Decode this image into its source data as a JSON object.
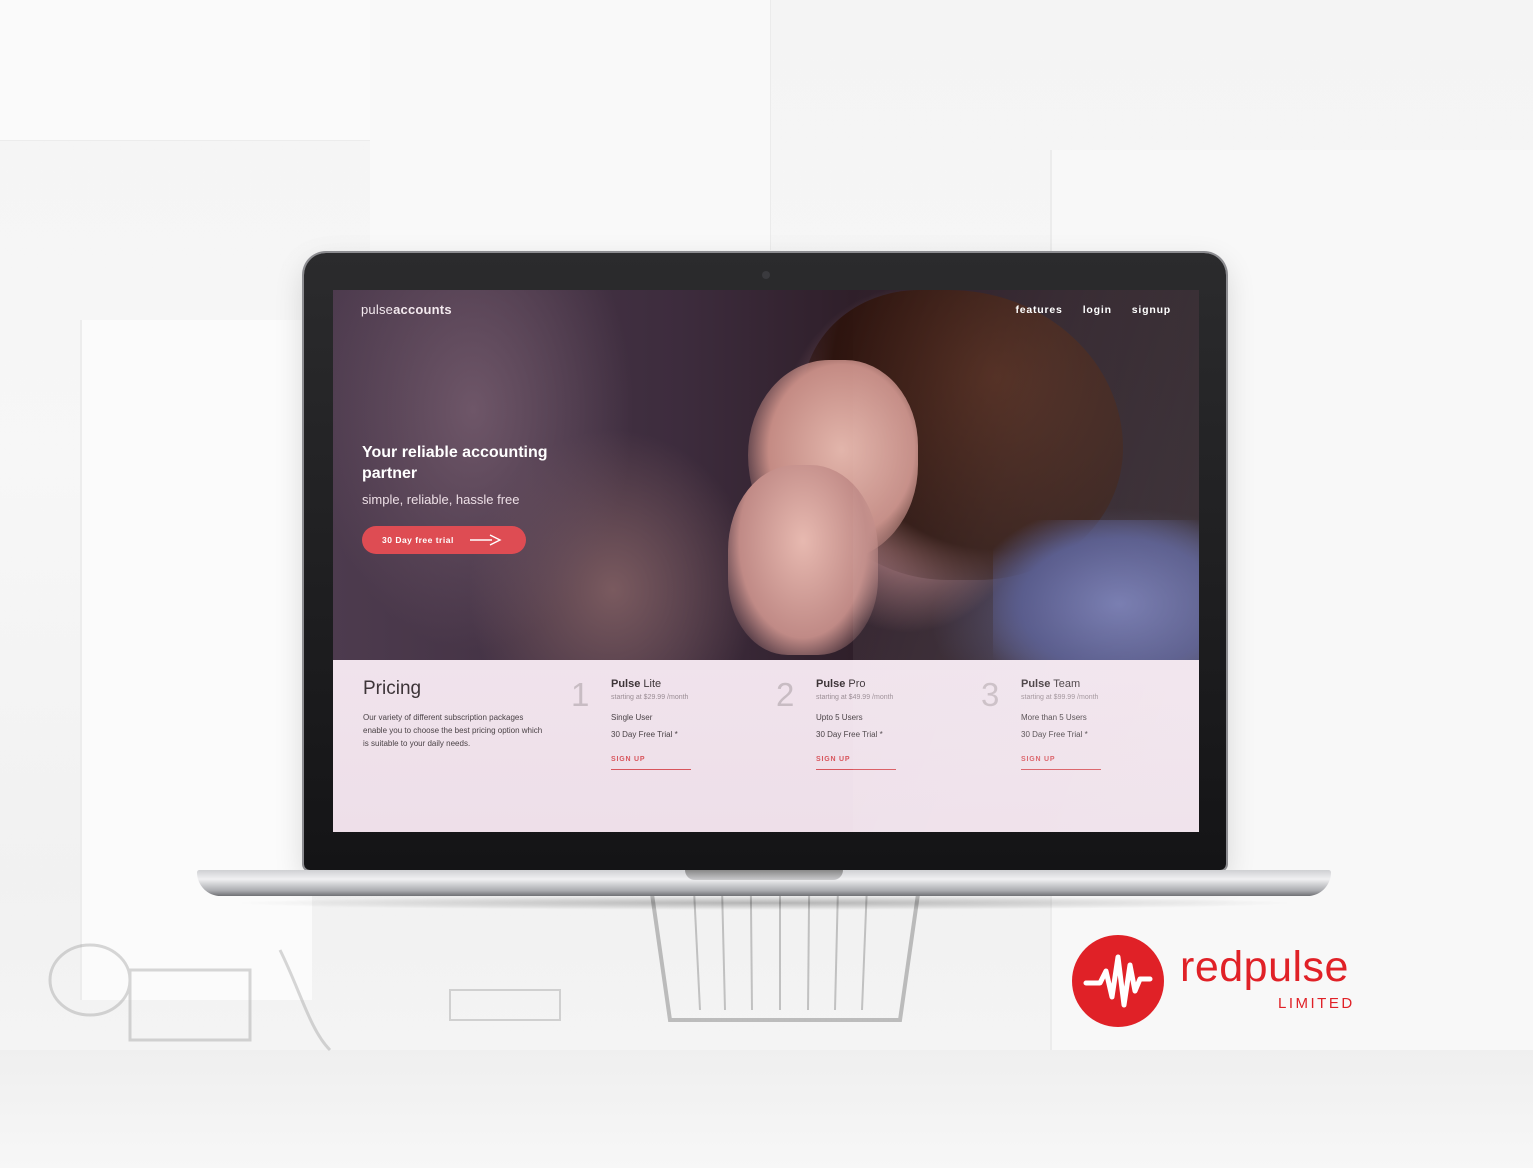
{
  "site": {
    "brand_light": "pulse",
    "brand_bold": "accounts",
    "nav": [
      "features",
      "login",
      "signup"
    ]
  },
  "hero": {
    "title": "Your reliable accounting partner",
    "subtitle": "simple, reliable, hassle free",
    "cta_label": "30 Day free trial"
  },
  "pricing": {
    "title": "Pricing",
    "description": "Our variety of different subscription packages enable you to choose the best pricing option which is suitable to your daily needs.",
    "plans": [
      {
        "number": "1",
        "name_bold": "Pulse",
        "name_light": "Lite",
        "price": "starting at $29.99 /month",
        "feature1": "Single User",
        "feature2": "30 Day Free Trial *",
        "signup": "SIGN UP"
      },
      {
        "number": "2",
        "name_bold": "Pulse",
        "name_light": "Pro",
        "price": "starting at $49.99 /month",
        "feature1": "Upto 5 Users",
        "feature2": "30 Day Free Trial *",
        "signup": "SIGN UP"
      },
      {
        "number": "3",
        "name_bold": "Pulse",
        "name_light": "Team",
        "price": "starting at $99.99 /month",
        "feature1": "More than 5 Users",
        "feature2": "30 Day Free Trial *",
        "signup": "SIGN UP"
      }
    ]
  },
  "company_logo": {
    "name": "redpulse",
    "tagline": "LIMITED"
  },
  "colors": {
    "accent": "#de4c53",
    "logo_red": "#e02127",
    "pricing_bg": "#f0e3ec"
  },
  "icons": [
    "arrow-right-icon",
    "pulse-wave-icon"
  ]
}
